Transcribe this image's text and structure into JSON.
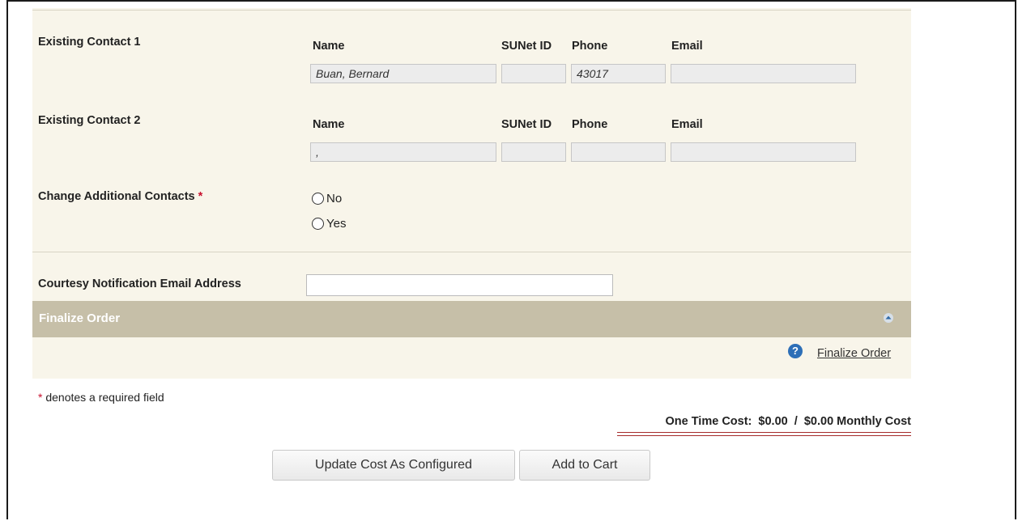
{
  "contacts": {
    "contact1": {
      "label": "Existing Contact 1",
      "name_header": "Name",
      "sunet_header": "SUNet ID",
      "phone_header": "Phone",
      "email_header": "Email",
      "name_value": "Buan, Bernard",
      "sunet_value": "",
      "phone_value": "43017",
      "email_value": ""
    },
    "contact2": {
      "label": "Existing Contact 2",
      "name_header": "Name",
      "sunet_header": "SUNet ID",
      "phone_header": "Phone",
      "email_header": "Email",
      "name_value": ",",
      "sunet_value": "",
      "phone_value": "",
      "email_value": ""
    }
  },
  "change_contacts": {
    "label": "Change Additional Contacts",
    "required_mark": "*",
    "options": [
      "No",
      "Yes"
    ]
  },
  "notification": {
    "label": "Courtesy Notification Email Address",
    "value": ""
  },
  "finalize": {
    "section_title": "Finalize Order",
    "link_label": "Finalize Order",
    "help_icon": "?"
  },
  "required_note": {
    "mark": "*",
    "text": " denotes a required field"
  },
  "cost": {
    "summary": "One Time Cost:  $0.00  /  $0.00 Monthly Cost"
  },
  "actions": {
    "update_label": "Update Cost As Configured",
    "add_label": "Add to Cart"
  },
  "colors": {
    "panel_bg": "#f8f5ea",
    "section_bar": "#c6bfa8",
    "required": "#c8102e",
    "help_icon": "#2d6fb7",
    "cost_underline": "#a62b2b"
  }
}
